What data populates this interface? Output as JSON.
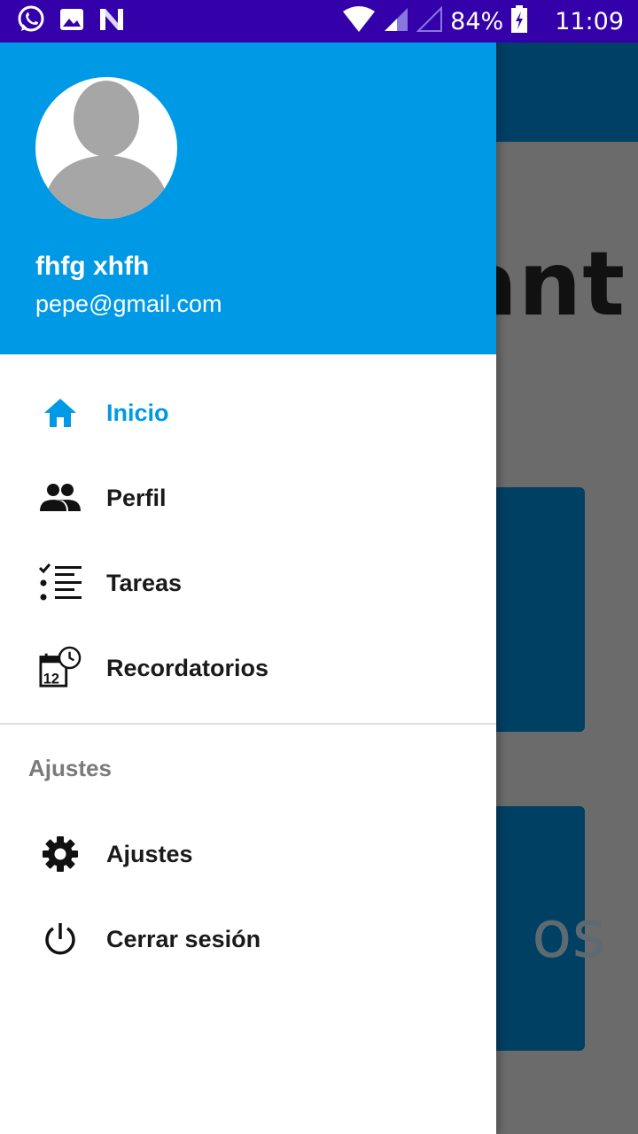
{
  "status_bar": {
    "battery": "84%",
    "time": "11:09",
    "icons": [
      "whatsapp-icon",
      "image-icon",
      "n-app-icon",
      "wifi-icon",
      "signal-icon",
      "signal-empty-icon",
      "battery-charging-icon"
    ]
  },
  "background": {
    "visible_word": "rant",
    "visible_card_text": "os"
  },
  "drawer": {
    "header_color": "#0099e5",
    "user_name": "fhfg xhfh",
    "user_email": "pepe@gmail.com",
    "items": [
      {
        "label": "Inicio",
        "icon": "home-icon",
        "active": true
      },
      {
        "label": "Perfil",
        "icon": "people-icon",
        "active": false
      },
      {
        "label": "Tareas",
        "icon": "checklist-icon",
        "active": false
      },
      {
        "label": "Recordatorios",
        "icon": "calendar-clock-icon",
        "active": false
      }
    ],
    "section_title": "Ajustes",
    "section_items": [
      {
        "label": "Ajustes",
        "icon": "gear-icon"
      },
      {
        "label": "Cerrar sesión",
        "icon": "power-icon"
      }
    ]
  }
}
